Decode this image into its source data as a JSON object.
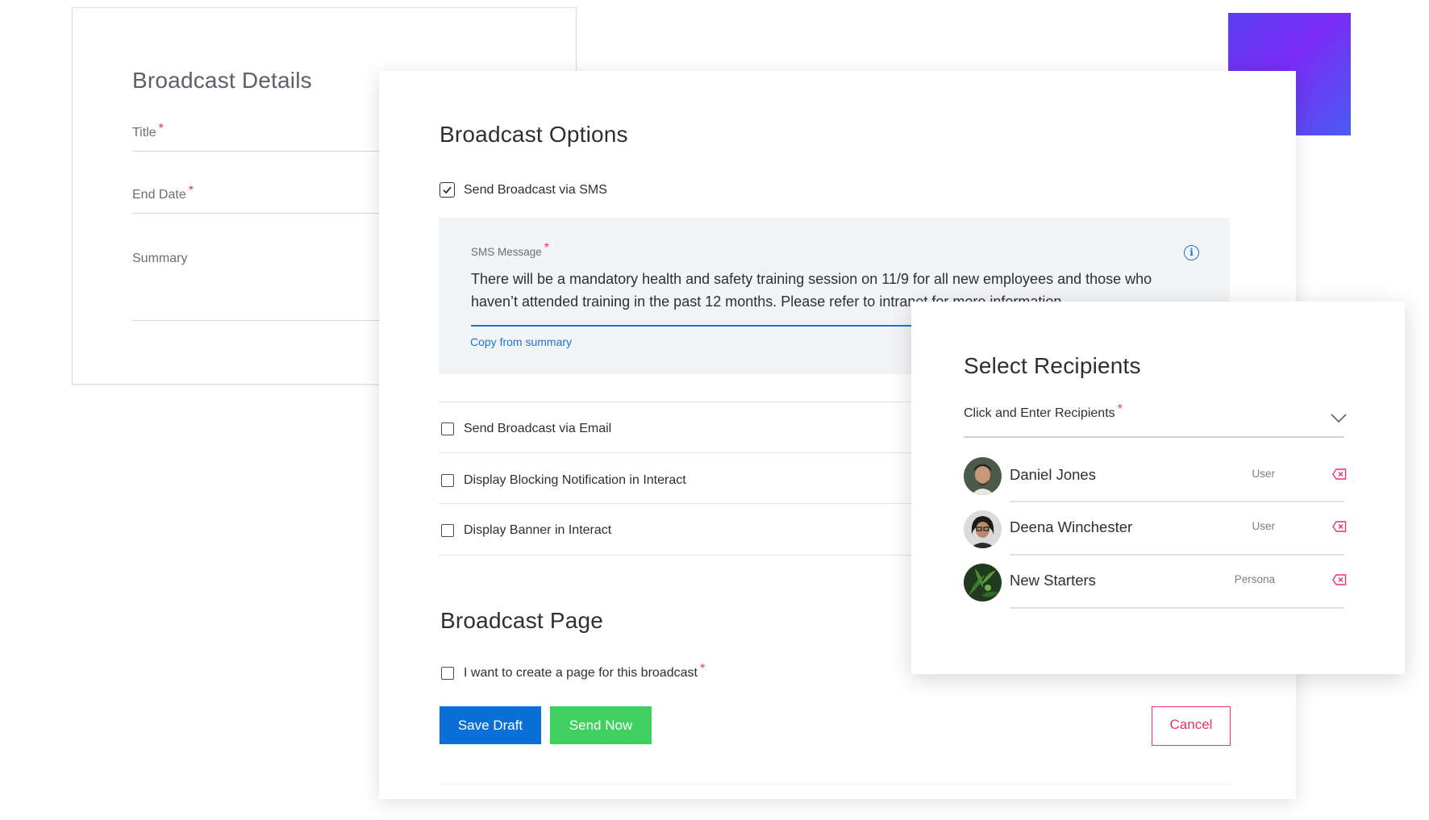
{
  "details": {
    "title": "Broadcast Details",
    "fields": [
      {
        "label": "Title",
        "required": "*"
      },
      {
        "label": "End Date",
        "required": "*"
      },
      {
        "label": "Summary",
        "required": ""
      }
    ]
  },
  "options": {
    "title": "Broadcast Options",
    "sms_option": {
      "label": "Send Broadcast via SMS",
      "checked": true
    },
    "sms_box": {
      "label": "SMS Message",
      "required": "*",
      "message": "There will be a mandatory health and safety training session on 11/9 for all new employees and those who haven’t attended training in the past 12 months. Please refer to intranet for more information.",
      "copy_link": "Copy from summary",
      "info_icon": "info-icon"
    },
    "other_options": [
      {
        "label": "Send Broadcast via Email",
        "checked": false
      },
      {
        "label": "Display Blocking Notification in Interact",
        "checked": false
      },
      {
        "label": "Display Banner in Interact",
        "checked": false
      }
    ],
    "page_section": {
      "title": "Broadcast Page",
      "checkbox_label": "I want to create a page for this broadcast",
      "required": "*"
    },
    "buttons": {
      "save": "Save Draft",
      "send": "Send Now",
      "cancel": "Cancel"
    }
  },
  "recipients": {
    "title": "Select Recipients",
    "select_label": "Click and Enter Recipients",
    "required": "*",
    "dropdown_icon": "chevron-down-icon",
    "items": [
      {
        "name": "Daniel Jones",
        "type": "User",
        "avatar": "avatar-photo"
      },
      {
        "name": "Deena Winchester",
        "type": "User",
        "avatar": "avatar-photo"
      },
      {
        "name": "New Starters",
        "type": "Persona",
        "avatar": "group-leaf-photo"
      }
    ],
    "remove_icon": "remove-icon"
  },
  "colors": {
    "primary": "#0b6fd8",
    "success": "#3fd05f",
    "danger": "#e8336b",
    "accent_gradient_start": "#5b3ef2",
    "accent_gradient_end": "#4a5cf2"
  }
}
